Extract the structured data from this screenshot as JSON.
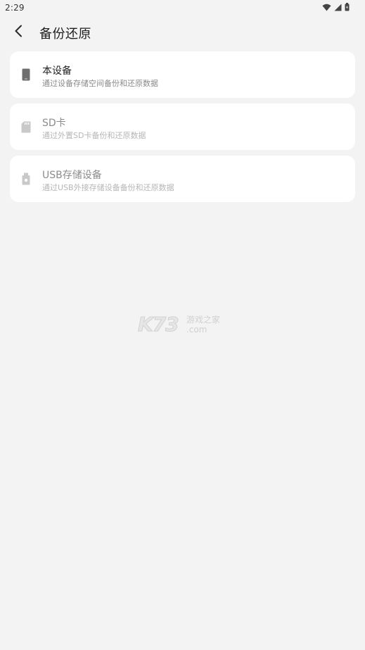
{
  "status_bar": {
    "time": "2:29",
    "icons": [
      "wifi-icon",
      "signal-icon",
      "battery-icon"
    ]
  },
  "header": {
    "back_icon": "back-arrow-icon",
    "title": "备份还原"
  },
  "options": [
    {
      "title": "本设备",
      "subtitle": "通过设备存储空间备份和还原数据",
      "icon": "phone-icon",
      "enabled": true
    },
    {
      "title": "SD卡",
      "subtitle": "通过外置SD卡备份和还原数据",
      "icon": "sd-card-icon",
      "enabled": false
    },
    {
      "title": "USB存储设备",
      "subtitle": "通过USB外接存储设备备份和还原数据",
      "icon": "usb-drive-icon",
      "enabled": false
    }
  ],
  "watermark": {
    "logo": "K73",
    "name": "游戏之家",
    "domain": ".com"
  },
  "colors": {
    "background": "#f3f3f3",
    "card": "#ffffff",
    "title_text": "#1e1e1e",
    "disabled_text": "#8c8c8c"
  }
}
